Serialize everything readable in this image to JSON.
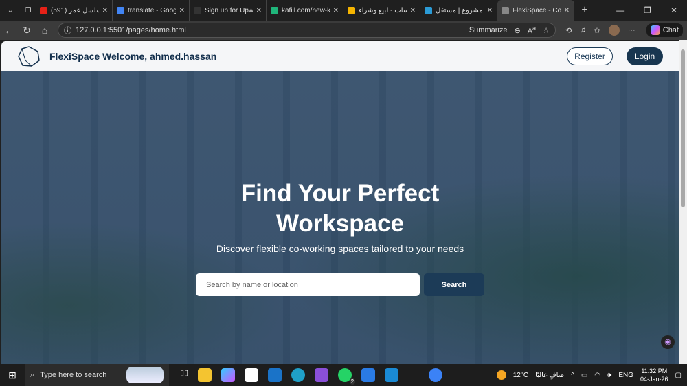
{
  "browser": {
    "tabs": [
      {
        "label": "(591) مسلسل عمر",
        "color": "#e62117"
      },
      {
        "label": "translate - Google",
        "color": "#4285f4"
      },
      {
        "label": "Sign up for Upwork",
        "color": "#333"
      },
      {
        "label": "kafiil.com/new-kafiil",
        "color": "#1fb57a"
      },
      {
        "label": "خمسات - لبيع وشراء",
        "color": "#f5b400"
      },
      {
        "label": "إضافة مشروع | مستقل",
        "color": "#2b9bd6"
      },
      {
        "label": "FlexiSpace - Co-working",
        "color": "#888",
        "active": true
      }
    ],
    "url": "127.0.0.1:5501/pages/home.html",
    "summarize": "Summarize",
    "chat": "Chat"
  },
  "navbar": {
    "brand": "FlexiSpace Welcome, ahmed.hassan",
    "register": "Register",
    "login": "Login"
  },
  "hero": {
    "title": "Find Your Perfect Workspace",
    "subtitle": "Discover flexible co-working spaces tailored to your needs",
    "search_placeholder": "Search by name or location",
    "search_button": "Search"
  },
  "taskbar": {
    "search": "Type here to search",
    "weather": "12°C",
    "weather_desc": "صافٍ غالبًا",
    "lang": "ENG",
    "time": "11:32 PM",
    "date": "04-Jan-26",
    "whatsapp_badge": "2"
  }
}
